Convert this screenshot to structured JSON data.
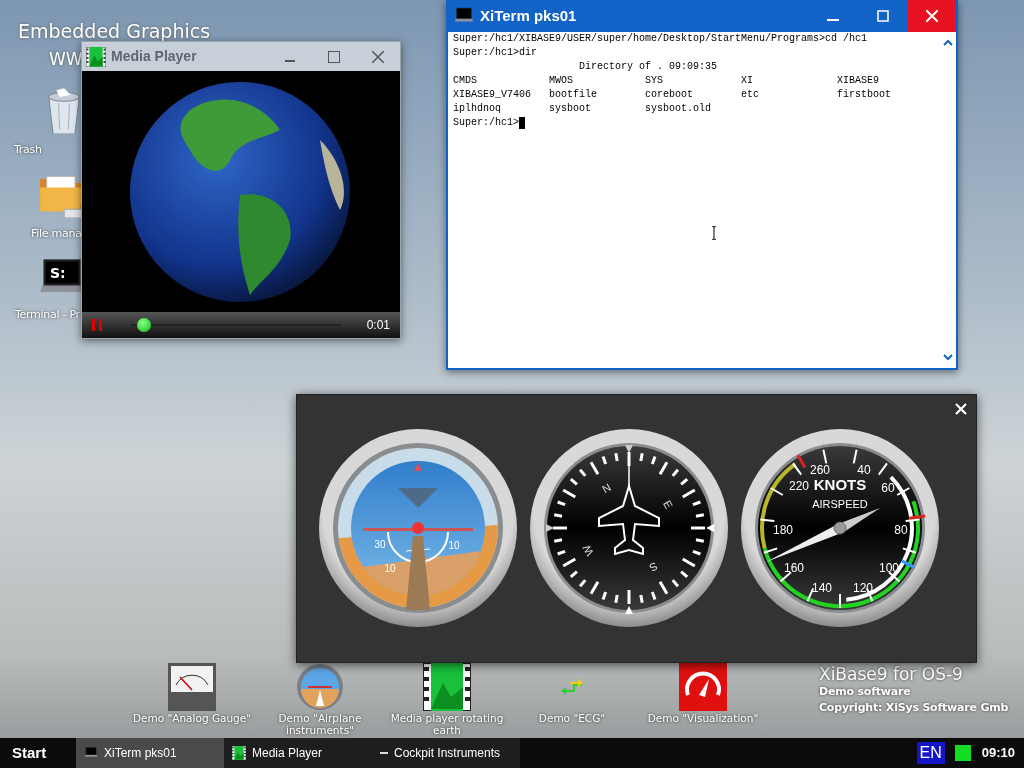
{
  "desktop": {
    "title": "Embedded Graphics",
    "subtitle": "WW",
    "icons": [
      {
        "label": "Trash",
        "kind": "trash"
      },
      {
        "label": "File mana",
        "kind": "folder"
      },
      {
        "label": "Terminal - Pr",
        "kind": "terminal",
        "icon_text": "S:"
      }
    ]
  },
  "media_player": {
    "title": "Media Player",
    "level": 0.06,
    "time": "0:01"
  },
  "terminal": {
    "title": "XiTerm pks01",
    "lines": [
      "Super:/hc1/XIBASE9/USER/super/home/Desktop/StartMenu/Programs>cd /hc1",
      "Super:/hc1>dir"
    ],
    "listing_header": "Directory of . 09:09:35",
    "listing": [
      [
        "CMDS",
        "MWOS",
        "SYS",
        "XI",
        "XIBASE9"
      ],
      [
        "XIBASE9_V7406",
        "bootfile",
        "coreboot",
        "etc",
        "firstboot"
      ],
      [
        "iplhdnoq",
        "sysboot",
        "sysboot.old"
      ]
    ],
    "prompt": "Super:/hc1>"
  },
  "cockpit": {
    "attitude_labels": [
      "30",
      "10",
      "10"
    ],
    "compass_labels": [
      "N",
      "E",
      "S",
      "W"
    ],
    "airspeed": {
      "title": "KNOTS",
      "subtitle": "AIRSPEED",
      "labels": [
        "260",
        "40",
        "60",
        "220",
        "180",
        "80",
        "160",
        "100",
        "140",
        "120"
      ]
    }
  },
  "launchers": [
    {
      "label": "Demo \"Analog Gauge\"",
      "kind": "gauge"
    },
    {
      "label": "Demo \"Airplane instruments\"",
      "kind": "airplane"
    },
    {
      "label": "Media player rotating earth",
      "kind": "media"
    },
    {
      "label": "Demo \"ECG\"",
      "kind": "ecg"
    },
    {
      "label": "Demo \"Visualization\"",
      "kind": "visualization"
    }
  ],
  "branding": {
    "title": "XiBase9 for OS-9",
    "lines": [
      "Demo software",
      "Copyright: XiSys Software Gmb"
    ]
  },
  "taskbar": {
    "start": "Start",
    "items": [
      {
        "label": "XiTerm pks01",
        "kind": "terminal",
        "selected": true
      },
      {
        "label": "Media Player",
        "kind": "media",
        "selected": false
      },
      {
        "label": "Cockpit Instruments",
        "kind": "cockpit",
        "selected": false
      }
    ],
    "language": "EN",
    "clock": "09:10"
  }
}
